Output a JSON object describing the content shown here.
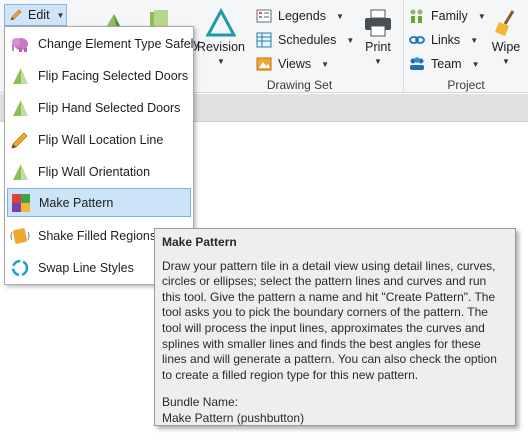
{
  "ribbon": {
    "edit_label": "Edit",
    "drawing_set": {
      "label": "Drawing Set",
      "revision_label": "Revision",
      "legends_label": "Legends",
      "schedules_label": "Schedules",
      "views_label": "Views",
      "print_label": "Print"
    },
    "project": {
      "label": "Project",
      "family_label": "Family",
      "links_label": "Links",
      "team_label": "Team",
      "wipe_label": "Wipe"
    }
  },
  "menu": {
    "items": [
      {
        "label": "Change Element Type Safely",
        "icon": "pink-elephant-icon"
      },
      {
        "label": "Flip Facing Selected Doors",
        "icon": "green-triangle-icon"
      },
      {
        "label": "Flip Hand Selected Doors",
        "icon": "green-triangle-icon"
      },
      {
        "label": "Flip Wall Location Line",
        "icon": "pencil-icon"
      },
      {
        "label": "Flip Wall Orientation",
        "icon": "green-triangle-icon"
      },
      {
        "label": "Make Pattern",
        "icon": "pattern-grid-icon"
      },
      {
        "label": "Shake Filled Regions",
        "icon": "shake-icon"
      },
      {
        "label": "Swap Line Styles",
        "icon": "swap-circle-icon"
      }
    ],
    "active_index": 5
  },
  "tooltip": {
    "title": "Make Pattern",
    "body": "Draw your pattern tile in a detail view using detail lines, curves, circles or ellipses; select the pattern lines and curves and run this tool. Give the pattern a name and hit \"Create Pattern\". The tool asks you to pick the boundary corners of the pattern. The tool will process the input lines, approximates the curves and splines with smaller lines and finds the best angles for these lines and will generate a pattern. You can also check the option to create a filled region type for this new pattern.",
    "bundle_label": "Bundle Name:",
    "bundle_value": "Make Pattern (pushbutton)"
  },
  "colors": {
    "accent": "#0078d7",
    "highlight_bg": "#cce4f7",
    "highlight_border": "#7bb4e3",
    "icon_green": "#8fbc5a",
    "icon_teal": "#1f9aa8"
  }
}
